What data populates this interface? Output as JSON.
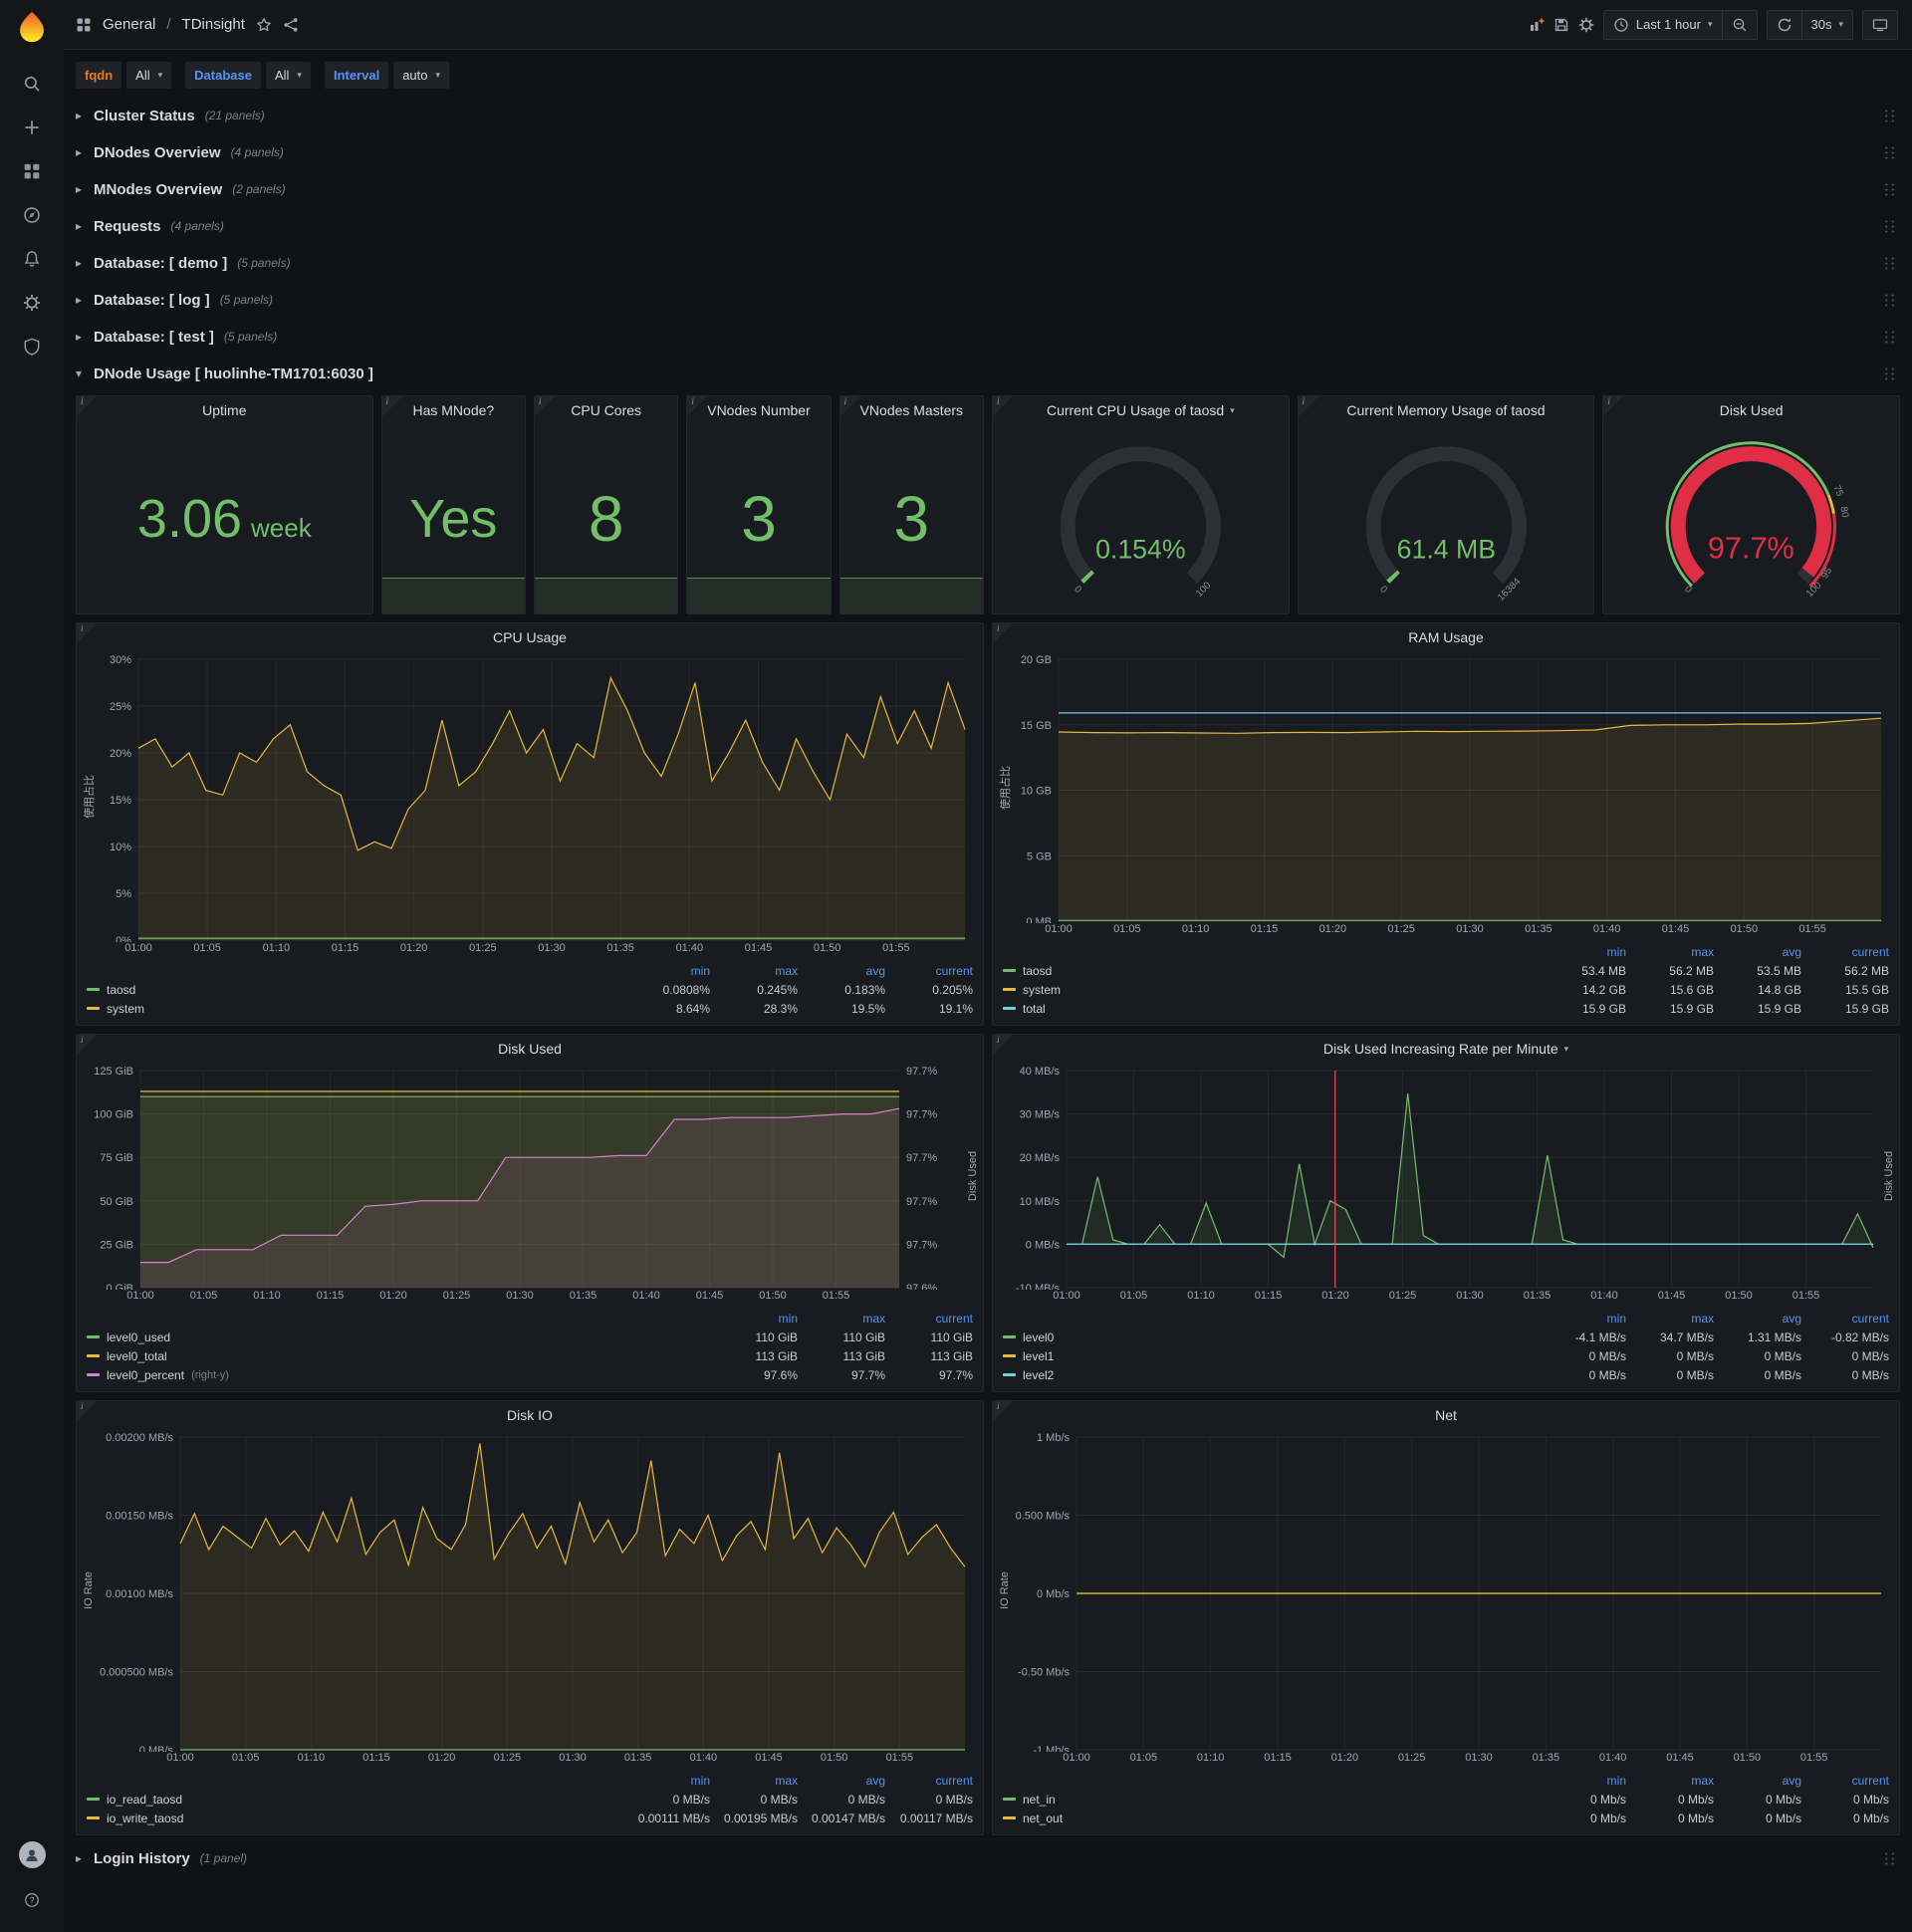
{
  "colors": {
    "green": "#73bf69",
    "yellow": "#eab839",
    "light_blue": "#6ed0e0",
    "red": "#e02f44",
    "pink": "#d683ce",
    "legend_header": "#5794f2",
    "orange_label": "#eb7b18"
  },
  "topnav": {
    "section": "General",
    "separator": "/",
    "page": "TDinsight",
    "time_label": "Last 1 hour",
    "refresh_label": "30s"
  },
  "sidebar_items": [
    {
      "icon": "search",
      "name": "search"
    },
    {
      "icon": "plus",
      "name": "create"
    },
    {
      "icon": "apps",
      "name": "dashboards"
    },
    {
      "icon": "compass",
      "name": "explore"
    },
    {
      "icon": "bell",
      "name": "alerting"
    },
    {
      "icon": "gear",
      "name": "configuration"
    },
    {
      "icon": "shield",
      "name": "server-admin"
    }
  ],
  "filters": [
    {
      "label": "fqdn",
      "value": "All",
      "label_color": "#eb7b18"
    },
    {
      "label": "Database",
      "value": "All",
      "label_color": "#5794f2"
    },
    {
      "label": "Interval",
      "value": "auto",
      "label_color": "#5794f2"
    }
  ],
  "collapsed_rows": [
    {
      "title": "Cluster Status",
      "count": "(21 panels)"
    },
    {
      "title": "DNodes Overview",
      "count": "(4 panels)"
    },
    {
      "title": "MNodes Overview",
      "count": "(2 panels)"
    },
    {
      "title": "Requests",
      "count": "(4 panels)"
    },
    {
      "title": "Database: [ demo ]",
      "count": "(5 panels)"
    },
    {
      "title": "Database: [ log ]",
      "count": "(5 panels)"
    },
    {
      "title": "Database: [ test ]",
      "count": "(5 panels)"
    }
  ],
  "expanded_row_title": "DNode Usage [ huolinhe-TM1701:6030 ]",
  "footer_row": {
    "title": "Login History",
    "count": "(1 panel)"
  },
  "stat_panels": [
    {
      "title": "Uptime",
      "value": "3.06",
      "unit": "week",
      "sparkline": false
    },
    {
      "title": "Has MNode?",
      "value": "Yes",
      "sparkline": true
    },
    {
      "title": "CPU Cores",
      "value": "8",
      "sparkline": true
    },
    {
      "title": "VNodes Number",
      "value": "3",
      "sparkline": true
    },
    {
      "title": "VNodes Masters",
      "value": "3",
      "sparkline": true
    }
  ],
  "gauge_panels": [
    {
      "id": "cpu",
      "title": "Current CPU Usage of taosd",
      "has_menu": true,
      "value": "0.154%",
      "frac": 0.00154,
      "color": "#73bf69",
      "big": false,
      "ticks": [
        {
          "label": "0",
          "frac": 0
        },
        {
          "label": "100",
          "frac": 1
        }
      ]
    },
    {
      "id": "mem",
      "title": "Current Memory Usage of taosd",
      "has_menu": false,
      "value": "61.4 MB",
      "frac": 0.00375,
      "color": "#73bf69",
      "big": false,
      "ticks": [
        {
          "label": "0",
          "frac": 0
        },
        {
          "label": "16384",
          "frac": 1
        }
      ]
    },
    {
      "id": "disk",
      "title": "Disk Used",
      "has_menu": false,
      "value": "97.7%",
      "frac": 0.977,
      "color": "#e02f44",
      "big": true,
      "ticks": [
        {
          "label": "0",
          "frac": 0
        },
        {
          "label": "75",
          "frac": 0.75
        },
        {
          "label": "80",
          "frac": 0.8
        },
        {
          "label": "95",
          "frac": 0.95
        },
        {
          "label": "100",
          "frac": 1
        }
      ],
      "ring": [
        {
          "from": 0,
          "to": 0.75,
          "color": "#73bf69"
        },
        {
          "from": 0.75,
          "to": 0.8,
          "color": "#eab839"
        },
        {
          "from": 0.8,
          "to": 1,
          "color": "#e02f44"
        }
      ]
    }
  ],
  "chart_panels": [
    {
      "id": "cpu-usage",
      "title": "CPU Usage",
      "has_menu": false,
      "type": "line",
      "left_label": "使用占比",
      "y_ticks": [
        "0%",
        "5%",
        "10%",
        "15%",
        "20%",
        "25%",
        "30%"
      ],
      "ymin": 0,
      "ymax": 30,
      "ml": 62,
      "mr": 18,
      "x_ticks": [
        "01:00",
        "01:05",
        "01:10",
        "01:15",
        "01:20",
        "01:25",
        "01:30",
        "01:35",
        "01:40",
        "01:45",
        "01:50",
        "01:55"
      ],
      "series": [
        {
          "name": "taosd",
          "color": "#73bf69",
          "fill": true,
          "values": [
            0.2,
            0.2
          ]
        },
        {
          "name": "system",
          "color": "#eab839",
          "fill": true,
          "values": [
            20.5,
            21.5,
            18.5,
            20,
            16,
            15.5,
            20,
            19,
            21.5,
            23,
            18,
            16.5,
            15.5,
            9.6,
            10.5,
            9.8,
            14,
            16,
            23.5,
            16.5,
            18,
            21,
            24.5,
            20,
            22.5,
            17,
            21,
            19.5,
            28,
            24.5,
            20,
            17.5,
            22,
            27.5,
            17,
            20,
            23.5,
            19,
            16,
            21.5,
            18,
            15,
            22,
            19.5,
            26,
            21,
            24.5,
            20.5,
            27.5,
            22.5
          ]
        }
      ],
      "legend": {
        "columns": [
          "min",
          "max",
          "avg",
          "current"
        ],
        "rows": [
          {
            "name": "taosd",
            "color": "#73bf69",
            "values": [
              "0.0808%",
              "0.245%",
              "0.183%",
              "0.205%"
            ]
          },
          {
            "name": "system",
            "color": "#eab839",
            "values": [
              "8.64%",
              "28.3%",
              "19.5%",
              "19.1%"
            ]
          }
        ]
      }
    },
    {
      "id": "ram-usage",
      "title": "RAM Usage",
      "has_menu": false,
      "type": "line",
      "left_label": "使用占比",
      "y_ticks": [
        "0 MB",
        "5 GB",
        "10 GB",
        "15 GB",
        "20 GB"
      ],
      "ymin": 0,
      "ymax": 20,
      "ml": 66,
      "mr": 18,
      "x_ticks": [
        "01:00",
        "01:05",
        "01:10",
        "01:15",
        "01:20",
        "01:25",
        "01:30",
        "01:35",
        "01:40",
        "01:45",
        "01:50",
        "01:55"
      ],
      "series": [
        {
          "name": "taosd",
          "color": "#73bf69",
          "fill": true,
          "values": [
            0.054,
            0.054
          ]
        },
        {
          "name": "system",
          "color": "#eab839",
          "fill": true,
          "values": [
            14.45,
            14.4,
            14.38,
            14.4,
            14.37,
            14.35,
            14.4,
            14.42,
            14.4,
            14.45,
            14.5,
            14.48,
            14.5,
            14.52,
            14.55,
            14.6,
            14.95,
            15.0,
            15.0,
            15.05,
            15.05,
            15.1,
            15.3,
            15.5
          ]
        },
        {
          "name": "total",
          "color": "#6ed0e0",
          "fill": false,
          "values": [
            15.9,
            15.9
          ]
        }
      ],
      "legend": {
        "columns": [
          "min",
          "max",
          "avg",
          "current"
        ],
        "rows": [
          {
            "name": "taosd",
            "color": "#73bf69",
            "values": [
              "53.4 MB",
              "56.2 MB",
              "53.5 MB",
              "56.2 MB"
            ]
          },
          {
            "name": "system",
            "color": "#eab839",
            "values": [
              "14.2 GB",
              "15.6 GB",
              "14.8 GB",
              "15.5 GB"
            ]
          },
          {
            "name": "total",
            "color": "#6ed0e0",
            "values": [
              "15.9 GB",
              "15.9 GB",
              "15.9 GB",
              "15.9 GB"
            ]
          }
        ]
      }
    },
    {
      "id": "disk-used",
      "title": "Disk Used",
      "has_menu": false,
      "type": "line",
      "right_label": "Disk Used",
      "y_ticks": [
        "0 GiB",
        "25 GiB",
        "50 GiB",
        "75 GiB",
        "100 GiB",
        "125 GiB"
      ],
      "ymin": 0,
      "ymax": 125,
      "right_ticks": [
        "97.6%",
        "97.7%",
        "97.7%",
        "97.7%",
        "97.7%",
        "97.7%"
      ],
      "rymin": 97.59,
      "rymax": 97.71,
      "ml": 64,
      "mr": 84,
      "x_ticks": [
        "01:00",
        "01:05",
        "01:10",
        "01:15",
        "01:20",
        "01:25",
        "01:30",
        "01:35",
        "01:40",
        "01:45",
        "01:50",
        "01:55"
      ],
      "series": [
        {
          "name": "level0_used",
          "color": "#73bf69",
          "fill": true,
          "values": [
            110,
            110
          ]
        },
        {
          "name": "level0_total",
          "color": "#eab839",
          "fill": true,
          "values": [
            113,
            113
          ]
        },
        {
          "name": "level0_percent",
          "color": "#d683ce",
          "fill": true,
          "right_axis": true,
          "values": [
            97.604,
            97.604,
            97.611,
            97.611,
            97.611,
            97.619,
            97.619,
            97.619,
            97.635,
            97.636,
            97.638,
            97.638,
            97.638,
            97.662,
            97.662,
            97.662,
            97.662,
            97.663,
            97.663,
            97.683,
            97.683,
            97.684,
            97.684,
            97.684,
            97.685,
            97.686,
            97.686,
            97.689
          ]
        }
      ],
      "legend": {
        "columns": [
          "min",
          "max",
          "current"
        ],
        "rows": [
          {
            "name": "level0_used",
            "color": "#73bf69",
            "values": [
              "110 GiB",
              "110 GiB",
              "110 GiB"
            ]
          },
          {
            "name": "level0_total",
            "color": "#eab839",
            "values": [
              "113 GiB",
              "113 GiB",
              "113 GiB"
            ]
          },
          {
            "name": "level0_percent",
            "suffix": "(right-y)",
            "color": "#d683ce",
            "values": [
              "97.6%",
              "97.7%",
              "97.7%"
            ]
          }
        ]
      }
    },
    {
      "id": "disk-rate",
      "title": "Disk Used Increasing Rate per Minute",
      "has_menu": true,
      "type": "line",
      "right_label": "Disk Used",
      "y_ticks": [
        "-10 MB/s",
        "0 MB/s",
        "10 MB/s",
        "20 MB/s",
        "30 MB/s",
        "40 MB/s"
      ],
      "ymin": -10,
      "ymax": 40,
      "ml": 74,
      "mr": 26,
      "x_ticks": [
        "01:00",
        "01:05",
        "01:10",
        "01:15",
        "01:20",
        "01:25",
        "01:30",
        "01:35",
        "01:40",
        "01:45",
        "01:50",
        "01:55"
      ],
      "annotations": [
        {
          "x": 0.333,
          "color": "#f2495c"
        }
      ],
      "series": [
        {
          "name": "level0",
          "color": "#73bf69",
          "fill": true,
          "values": [
            0,
            0,
            15.5,
            1,
            0,
            0,
            4.5,
            0,
            0,
            9.5,
            0,
            0,
            0,
            0,
            -3,
            18.5,
            0,
            10,
            8,
            0,
            0,
            0,
            34.7,
            2,
            0,
            0,
            0,
            0,
            0,
            0,
            0,
            20.5,
            1,
            0,
            0,
            0,
            0,
            0,
            0,
            0,
            0,
            0,
            0,
            0,
            0,
            0,
            0,
            0,
            0,
            0,
            0,
            7,
            -0.8
          ]
        },
        {
          "name": "level1",
          "color": "#eab839",
          "fill": false,
          "values": [
            0,
            0
          ]
        },
        {
          "name": "level2",
          "color": "#6ed0e0",
          "fill": false,
          "values": [
            0,
            0
          ]
        }
      ],
      "legend": {
        "columns": [
          "min",
          "max",
          "avg",
          "current"
        ],
        "rows": [
          {
            "name": "level0",
            "color": "#73bf69",
            "values": [
              "-4.1 MB/s",
              "34.7 MB/s",
              "1.31 MB/s",
              "-0.82 MB/s"
            ]
          },
          {
            "name": "level1",
            "color": "#eab839",
            "values": [
              "0 MB/s",
              "0 MB/s",
              "0 MB/s",
              "0 MB/s"
            ]
          },
          {
            "name": "level2",
            "color": "#6ed0e0",
            "values": [
              "0 MB/s",
              "0 MB/s",
              "0 MB/s",
              "0 MB/s"
            ]
          }
        ]
      }
    },
    {
      "id": "disk-io",
      "title": "Disk IO",
      "has_menu": false,
      "type": "line",
      "left_label": "IO Rate",
      "y_ticks": [
        "0 MB/s",
        "0.000500 MB/s",
        "0.00100 MB/s",
        "0.00150 MB/s",
        "0.00200 MB/s"
      ],
      "ymin": 0,
      "ymax": 0.002,
      "ml": 104,
      "mr": 18,
      "x_ticks": [
        "01:00",
        "01:05",
        "01:10",
        "01:15",
        "01:20",
        "01:25",
        "01:30",
        "01:35",
        "01:40",
        "01:45",
        "01:50",
        "01:55"
      ],
      "series": [
        {
          "name": "io_read_taosd",
          "color": "#73bf69",
          "fill": true,
          "values": [
            0,
            0
          ]
        },
        {
          "name": "io_write_taosd",
          "color": "#eab839",
          "fill": true,
          "values": [
            0.00132,
            0.00151,
            0.00128,
            0.00143,
            0.00136,
            0.00129,
            0.00148,
            0.00131,
            0.0014,
            0.00127,
            0.00152,
            0.00133,
            0.00161,
            0.00125,
            0.00139,
            0.00147,
            0.00118,
            0.00155,
            0.00135,
            0.00128,
            0.00144,
            0.00196,
            0.00122,
            0.00138,
            0.00151,
            0.00129,
            0.00143,
            0.00119,
            0.00158,
            0.00133,
            0.00147,
            0.00126,
            0.00139,
            0.00185,
            0.00124,
            0.00141,
            0.00132,
            0.0015,
            0.00121,
            0.00137,
            0.00146,
            0.00128,
            0.0019,
            0.00135,
            0.00148,
            0.00126,
            0.00142,
            0.00131,
            0.00117,
            0.00139,
            0.00152,
            0.00125,
            0.00136,
            0.00144,
            0.00129,
            0.00117
          ]
        }
      ],
      "legend": {
        "columns": [
          "min",
          "max",
          "avg",
          "current"
        ],
        "rows": [
          {
            "name": "io_read_taosd",
            "color": "#73bf69",
            "values": [
              "0 MB/s",
              "0 MB/s",
              "0 MB/s",
              "0 MB/s"
            ]
          },
          {
            "name": "io_write_taosd",
            "color": "#eab839",
            "values": [
              "0.00111 MB/s",
              "0.00195 MB/s",
              "0.00147 MB/s",
              "0.00117 MB/s"
            ]
          }
        ]
      }
    },
    {
      "id": "net",
      "title": "Net",
      "has_menu": false,
      "type": "line",
      "left_label": "IO Rate",
      "y_ticks": [
        "-1 Mb/s",
        "-0.50 Mb/s",
        "0 Mb/s",
        "0.500 Mb/s",
        "1 Mb/s"
      ],
      "ymin": -1,
      "ymax": 1,
      "ml": 84,
      "mr": 18,
      "x_ticks": [
        "01:00",
        "01:05",
        "01:10",
        "01:15",
        "01:20",
        "01:25",
        "01:30",
        "01:35",
        "01:40",
        "01:45",
        "01:50",
        "01:55"
      ],
      "series": [
        {
          "name": "net_in",
          "color": "#73bf69",
          "fill": false,
          "values": [
            0,
            0
          ]
        },
        {
          "name": "net_out",
          "color": "#eab839",
          "fill": false,
          "values": [
            0,
            0
          ]
        }
      ],
      "legend": {
        "columns": [
          "min",
          "max",
          "avg",
          "current"
        ],
        "rows": [
          {
            "name": "net_in",
            "color": "#73bf69",
            "values": [
              "0 Mb/s",
              "0 Mb/s",
              "0 Mb/s",
              "0 Mb/s"
            ]
          },
          {
            "name": "net_out",
            "color": "#eab839",
            "values": [
              "0 Mb/s",
              "0 Mb/s",
              "0 Mb/s",
              "0 Mb/s"
            ]
          }
        ]
      }
    }
  ]
}
